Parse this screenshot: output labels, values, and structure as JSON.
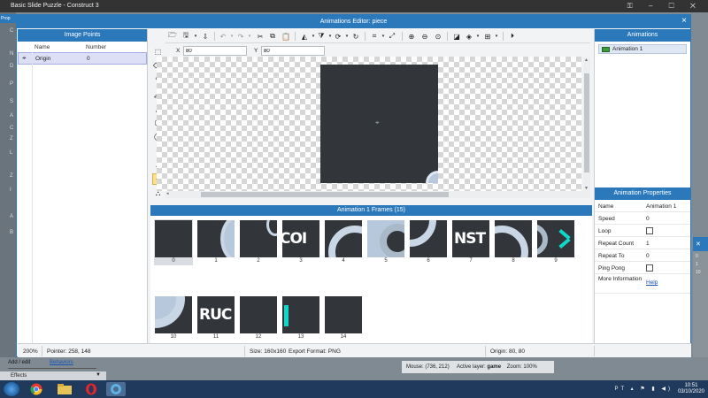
{
  "app": {
    "title": "Basic Slide Puzzle - Construct 3",
    "side_label": "Prop",
    "side_letters": [
      "C",
      "N",
      "D",
      "P",
      "S",
      "A",
      "C",
      "Z",
      "L",
      "Z",
      "I",
      "A",
      "B"
    ],
    "right_numbers": [
      "0",
      "1",
      "10"
    ]
  },
  "dialog": {
    "title": "Animations Editor: piece",
    "close_glyph": "×"
  },
  "image_points": {
    "title": "Image Points",
    "col_name": "Name",
    "col_number": "Number",
    "rows": [
      {
        "name": "Origin",
        "number": "0"
      }
    ]
  },
  "coords": {
    "x_label": "X",
    "x_value": "80",
    "y_label": "Y",
    "y_value": "80"
  },
  "animations": {
    "title": "Animations",
    "items": [
      {
        "label": "Animation 1",
        "color": "#3c9a3a"
      }
    ]
  },
  "properties": {
    "title": "Animation Properties",
    "rows": [
      {
        "key": "Name",
        "value": "Animation 1"
      },
      {
        "key": "Speed",
        "value": "0"
      },
      {
        "key": "Loop",
        "value": ""
      },
      {
        "key": "Repeat Count",
        "value": "1"
      },
      {
        "key": "Repeat To",
        "value": "0"
      },
      {
        "key": "Ping Pong",
        "value": ""
      }
    ],
    "more_key": "More Information",
    "more_link": "Help"
  },
  "frames": {
    "title": "Animation 1 Frames (15)",
    "labels": [
      "0",
      "1",
      "2",
      "3",
      "4",
      "5",
      "6",
      "7",
      "8",
      "9",
      "10",
      "11",
      "12",
      "13",
      "14"
    ],
    "texts": {
      "3": "COI",
      "7": "NST",
      "11": "RUC"
    }
  },
  "status": {
    "zoom": "200%",
    "pointer": "Pointer: 258, 148",
    "size": "Size: 160x160",
    "export": "Export Format: PNG",
    "origin": "Origin: 80, 80"
  },
  "background_bottom": {
    "tab_add": "Add / edit",
    "tab_behaviors": "Behaviors",
    "effects": "Effects",
    "mouse": "Mouse: (736, 212)",
    "active_layer_label": "Active layer:",
    "active_layer_value": "game",
    "zoom": "Zoom: 100%"
  },
  "taskbar": {
    "language": "PT",
    "time": "10:51",
    "date": "03/10/2020"
  },
  "colors": {
    "accent": "#2b79bb",
    "sprite": "#323539",
    "highlight_tool": "#fbe08f",
    "cyan": "#10d8c8"
  }
}
